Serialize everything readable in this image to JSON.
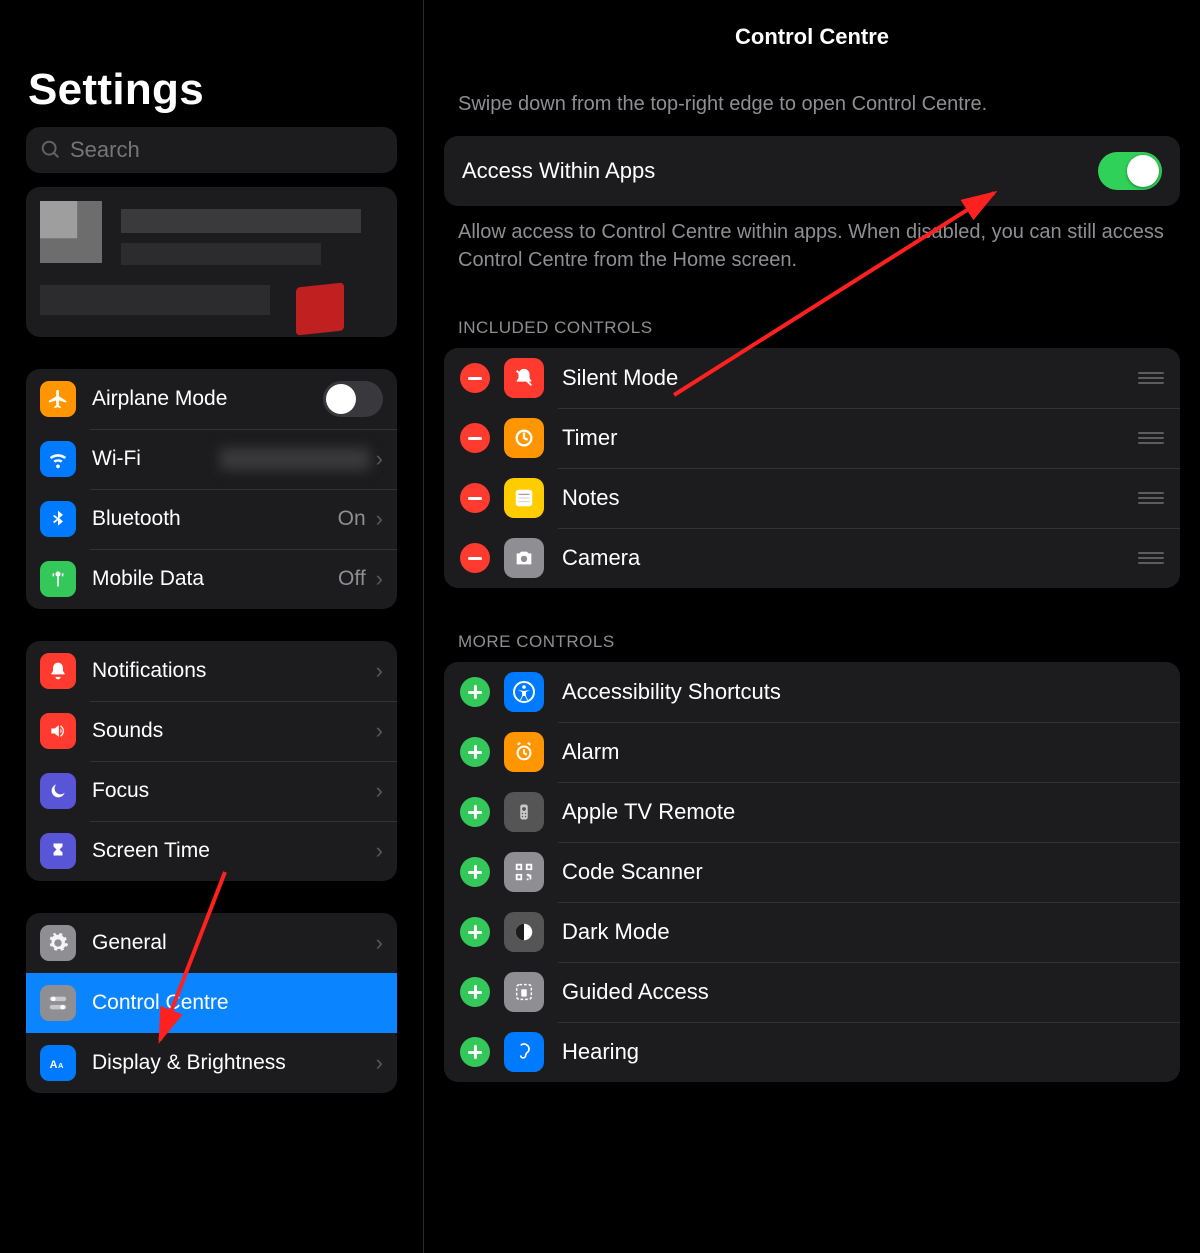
{
  "sidebar": {
    "title": "Settings",
    "search_placeholder": "Search",
    "groups": [
      [
        {
          "icon": "airplane-icon",
          "bg": "bg-orange",
          "label": "Airplane Mode",
          "type": "toggle",
          "on": false
        },
        {
          "icon": "wifi-icon",
          "bg": "bg-blue",
          "label": "Wi-Fi",
          "type": "value-blur",
          "value": ""
        },
        {
          "icon": "bluetooth-icon",
          "bg": "bg-blue",
          "label": "Bluetooth",
          "type": "value",
          "value": "On"
        },
        {
          "icon": "antenna-icon",
          "bg": "bg-green",
          "label": "Mobile Data",
          "type": "value",
          "value": "Off"
        }
      ],
      [
        {
          "icon": "bell-icon",
          "bg": "bg-red",
          "label": "Notifications",
          "type": "chev"
        },
        {
          "icon": "speaker-icon",
          "bg": "bg-red",
          "label": "Sounds",
          "type": "chev"
        },
        {
          "icon": "moon-icon",
          "bg": "bg-indigo",
          "label": "Focus",
          "type": "chev"
        },
        {
          "icon": "hourglass-icon",
          "bg": "bg-indigo",
          "label": "Screen Time",
          "type": "chev"
        }
      ],
      [
        {
          "icon": "gear-icon",
          "bg": "bg-gray",
          "label": "General",
          "type": "chev"
        },
        {
          "icon": "switches-icon",
          "bg": "bg-gray",
          "label": "Control Centre",
          "type": "none",
          "selected": true
        },
        {
          "icon": "text-size-icon",
          "bg": "bg-blue",
          "label": "Display & Brightness",
          "type": "chev"
        }
      ]
    ]
  },
  "main": {
    "title": "Control Centre",
    "intro": "Swipe down from the top-right edge to open Control Centre.",
    "access_toggle": {
      "label": "Access Within Apps",
      "on": true
    },
    "access_desc": "Allow access to Control Centre within apps. When disabled, you can still access Control Centre from the Home screen.",
    "included_header": "INCLUDED CONTROLS",
    "included": [
      {
        "icon": "bell-slash-icon",
        "bg": "bg-red",
        "label": "Silent Mode"
      },
      {
        "icon": "timer-icon",
        "bg": "bg-orange",
        "label": "Timer"
      },
      {
        "icon": "notes-icon",
        "bg": "bg-yellow",
        "label": "Notes"
      },
      {
        "icon": "camera-icon",
        "bg": "bg-gray",
        "label": "Camera"
      }
    ],
    "more_header": "MORE CONTROLS",
    "more": [
      {
        "icon": "accessibility-icon",
        "bg": "bg-blue",
        "label": "Accessibility Shortcuts"
      },
      {
        "icon": "alarm-icon",
        "bg": "bg-orange",
        "label": "Alarm"
      },
      {
        "icon": "tv-remote-icon",
        "bg": "bg-dkgray",
        "label": "Apple TV Remote"
      },
      {
        "icon": "qr-icon",
        "bg": "bg-gray",
        "label": "Code Scanner"
      },
      {
        "icon": "darkmode-icon",
        "bg": "bg-dkgray",
        "label": "Dark Mode"
      },
      {
        "icon": "guided-icon",
        "bg": "bg-gray",
        "label": "Guided Access"
      },
      {
        "icon": "ear-icon",
        "bg": "bg-blue",
        "label": "Hearing"
      }
    ]
  }
}
